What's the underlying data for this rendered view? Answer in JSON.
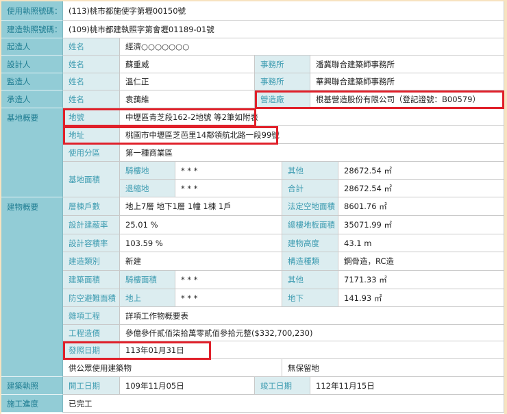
{
  "use_permit": {
    "label": "使用執照號碼：",
    "value": "(113)桃市都施使字第壢00150號"
  },
  "build_permit": {
    "label": "建造執照號碼：",
    "value": "(109)桃市都建執照字第會壢01189-01號"
  },
  "owner": {
    "label": "起造人",
    "name_label": "姓名",
    "name": "經濟○○○○○○○"
  },
  "designer": {
    "label": "設計人",
    "name_label": "姓名",
    "name": "蘇重威",
    "office_label": "事務所",
    "office": "潘冀聯合建築師事務所"
  },
  "supervisor": {
    "label": "監造人",
    "name_label": "姓名",
    "name": "溫仁正",
    "office_label": "事務所",
    "office": "華興聯合建築師事務所"
  },
  "contractor": {
    "label": "承造人",
    "name_label": "姓名",
    "name": "袁藹維",
    "firm_label": "營造廠",
    "firm": "根基營造股份有限公司（登記證號：B00579）"
  },
  "site": {
    "label": "基地概要",
    "lot_label": "地號",
    "lot": "中壢區青芝段162-2地號 等2筆如附表",
    "address_label": "地址",
    "address": "桃園市中壢區芝芭里14鄰領航北路一段99號",
    "zoning_label": "使用分區",
    "zoning": "第一種商業區",
    "area_label": "基地面積",
    "arcade_label": "騎樓地",
    "arcade": "* * *",
    "other_label": "其他",
    "other": "28672.54 ㎡",
    "setback_label": "退縮地",
    "setback": "* * *",
    "total_label": "合計",
    "total": "28672.54 ㎡"
  },
  "building": {
    "label": "建物概要",
    "floors_label": "層棟戶數",
    "floors": "地上7層 地下1層 1幢 1棟 1戶",
    "open_label": "法定空地面積",
    "open": "8601.76 ㎡",
    "coverage_label": "設計建蔽率",
    "coverage": "25.01 %",
    "floor_area_label": "總樓地板面積",
    "floor_area": "35071.99 ㎡",
    "far_label": "設計容積率",
    "far": "103.59 %",
    "height_label": "建物高度",
    "height": "43.1 m",
    "type_label": "建造類別",
    "type": "新建",
    "structure_label": "構造種類",
    "structure": "鋼骨造，RC造",
    "build_area_label": "建築面積",
    "arcade_area_label": "騎樓面積",
    "arcade_area": "* * *",
    "other_label": "其他",
    "other": "7171.33 ㎡",
    "shelter_label": "防空避難面積",
    "above_label": "地上",
    "above": "* * *",
    "below_label": "地下",
    "below": "141.93 ㎡",
    "misc_label": "雜項工程",
    "misc": "詳項工作物概要表",
    "cost_label": "工程造價",
    "cost": "參億參仟貳佰柒拾萬零貳佰參拾元整($332,700,230)",
    "issue_label": "發照日期",
    "issue": "113年01月31日",
    "public": "供公眾使用建築物",
    "reserve": "無保留地"
  },
  "license": {
    "label": "建築執照",
    "start_label": "開工日期",
    "start": "109年11月05日",
    "end_label": "竣工日期",
    "end": "112年11月15日"
  },
  "progress": {
    "label": "施工進度",
    "value": "已完工"
  }
}
